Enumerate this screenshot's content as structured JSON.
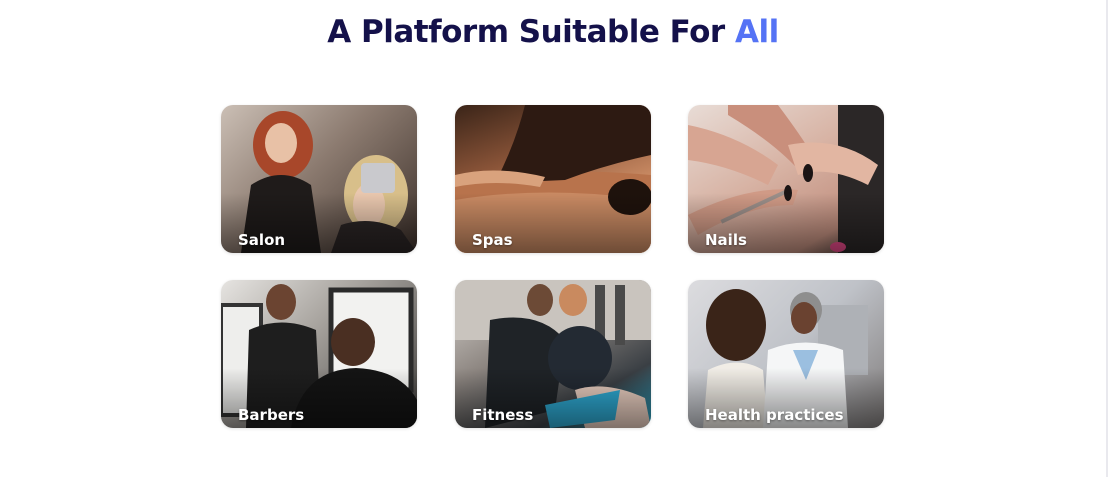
{
  "heading": {
    "text_main": "A Platform Suitable For ",
    "text_accent": "All",
    "color_main": "#14114a",
    "color_accent": "#5573f5"
  },
  "cards": [
    {
      "label": "Salon"
    },
    {
      "label": "Spas"
    },
    {
      "label": "Nails"
    },
    {
      "label": "Barbers"
    },
    {
      "label": "Fitness"
    },
    {
      "label": "Health practices"
    }
  ]
}
